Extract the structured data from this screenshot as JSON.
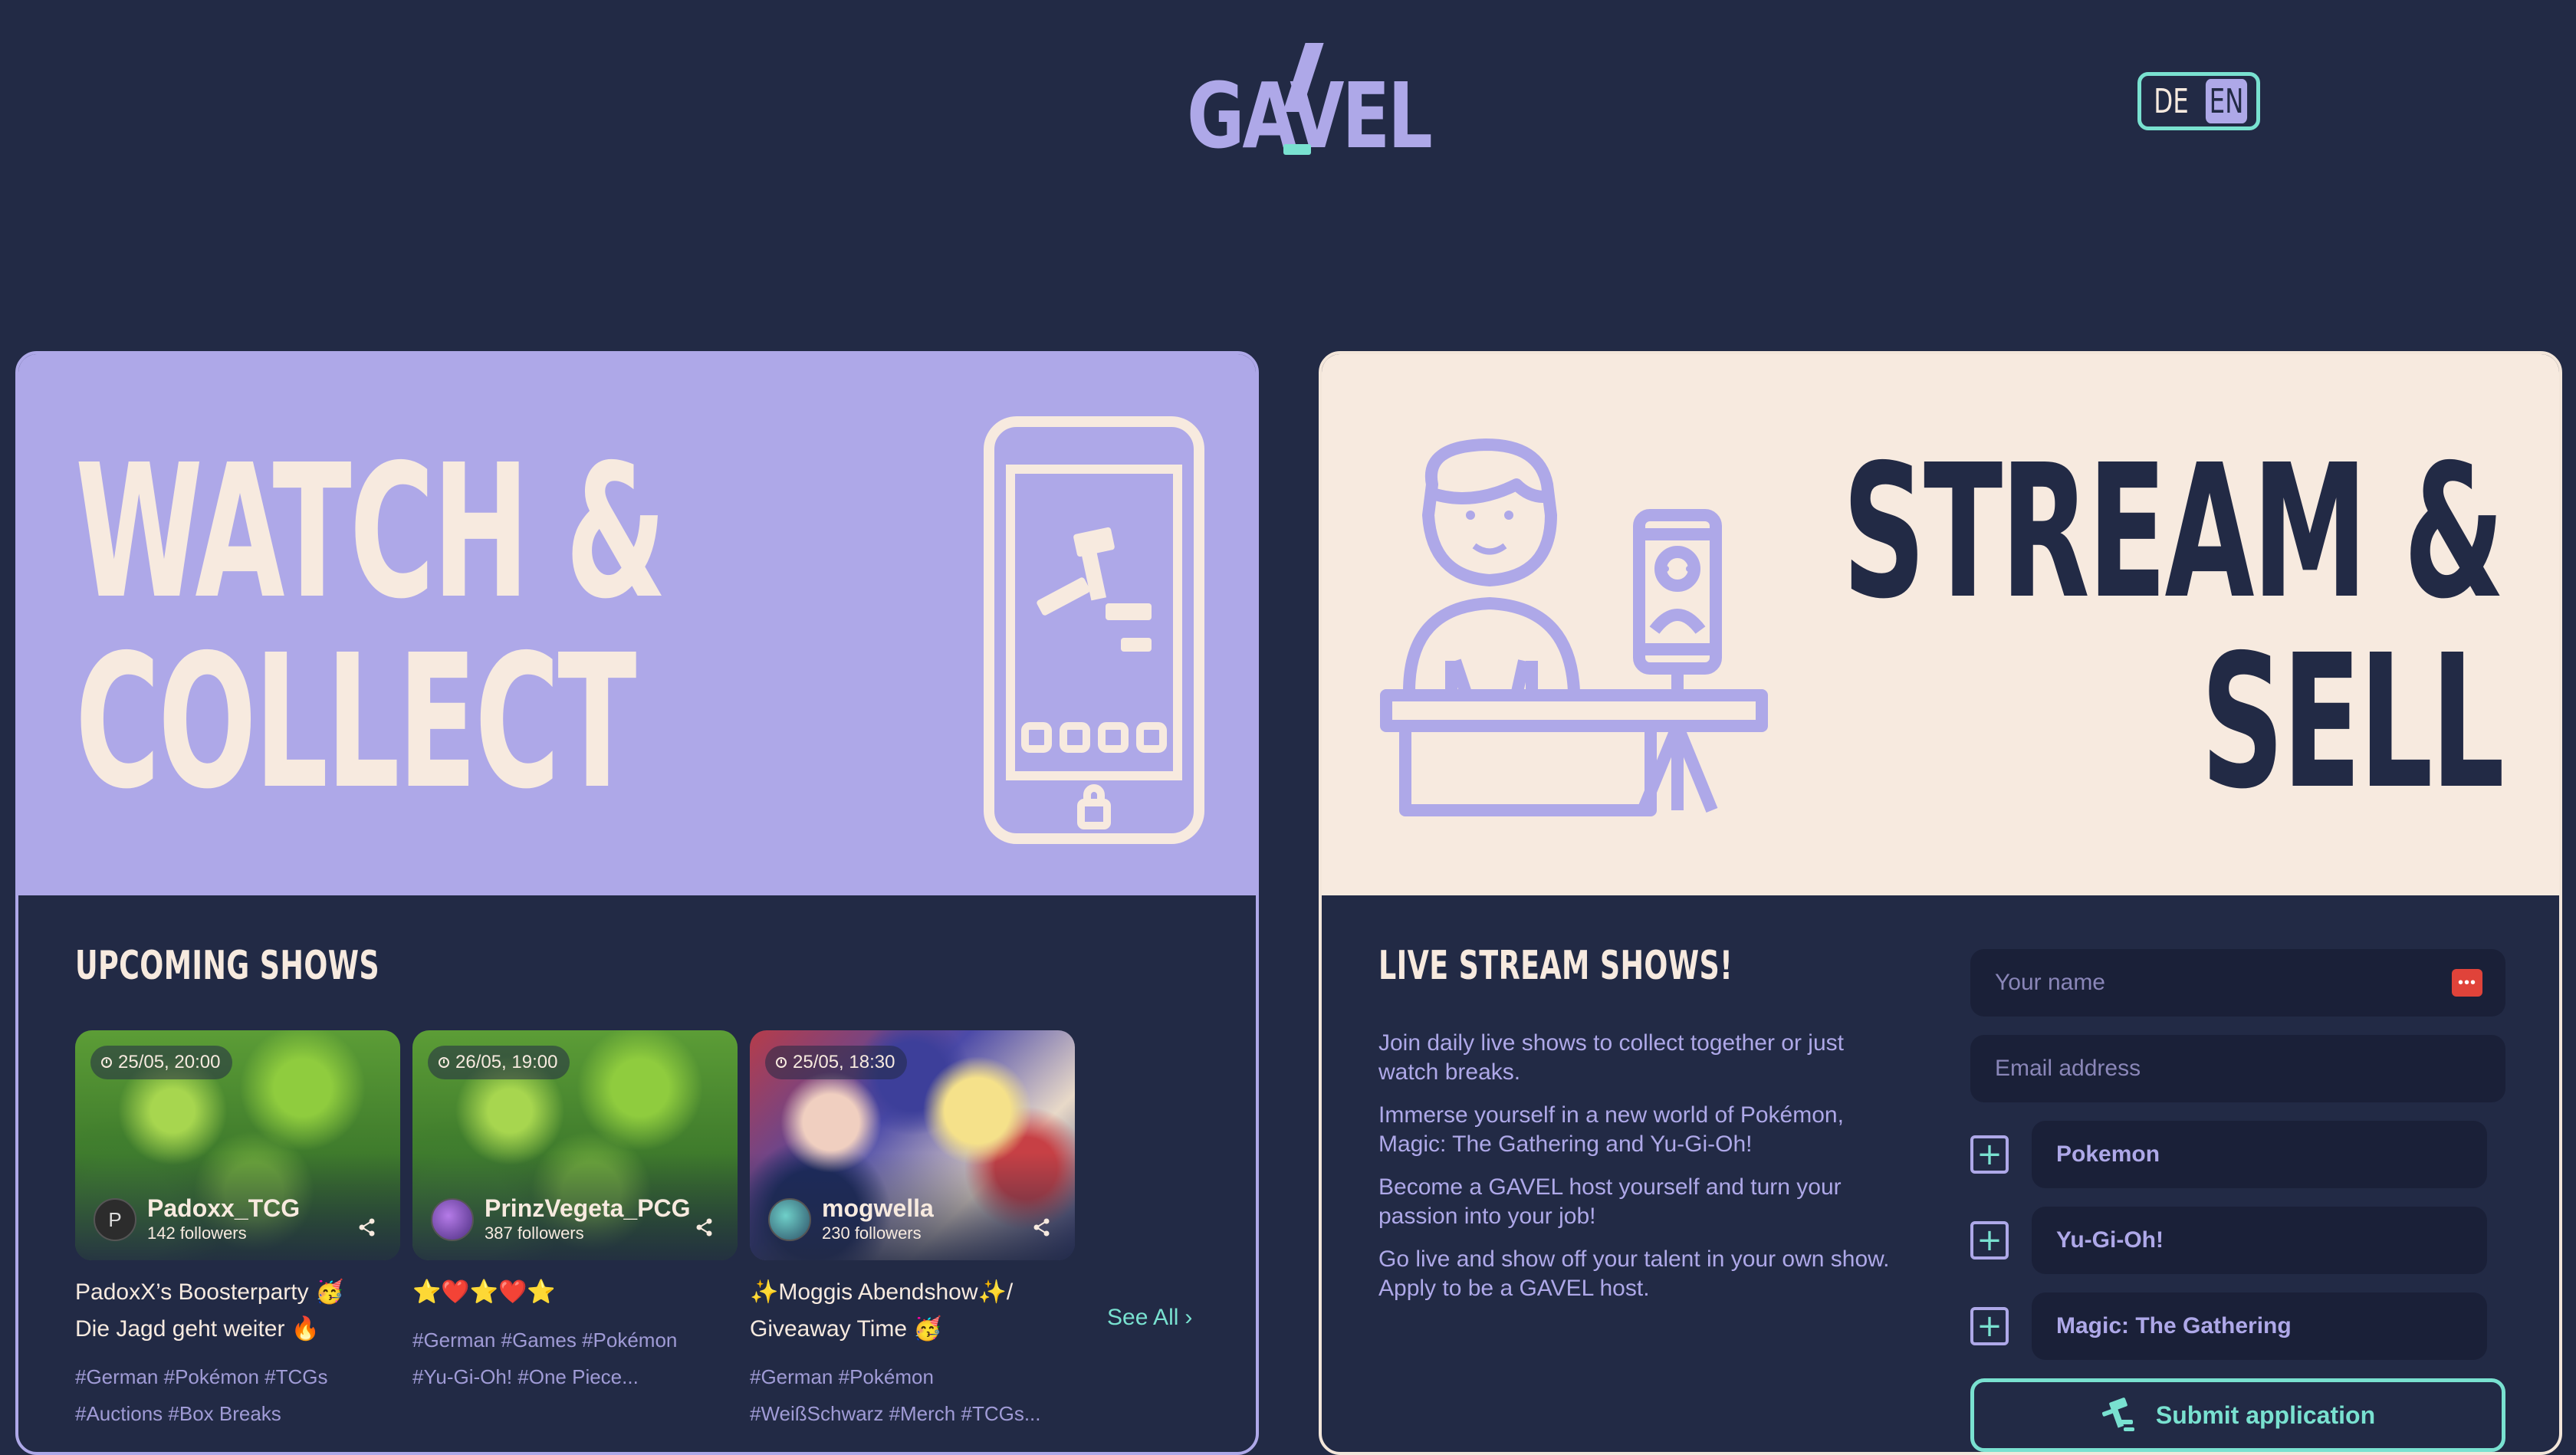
{
  "brand": {
    "logo_text": "GAVEL"
  },
  "language": {
    "options": [
      "DE",
      "EN"
    ],
    "active": "EN"
  },
  "watch": {
    "hero_line1": "WATCH &",
    "hero_line2": "COLLECT",
    "section_title": "UPCOMING SHOWS",
    "see_all": "See All",
    "cards": [
      {
        "time": "25/05, 20:00",
        "host": "Padoxx_TCG",
        "followers": "142 followers",
        "avatar": "P",
        "title_line1": "PadoxX’s Boosterparty 🥳",
        "title_line2": "Die Jagd geht weiter 🔥",
        "tags_line1": "#German #Pokémon #TCGs",
        "tags_line2": "#Auctions #Box Breaks"
      },
      {
        "time": "26/05, 19:00",
        "host": "PrinzVegeta_PCG",
        "followers": "387 followers",
        "avatar": "",
        "title_line1": "⭐❤️⭐❤️⭐",
        "title_line2": "",
        "tags_line1": "#German #Games #Pokémon",
        "tags_line2": "#Yu-Gi-Oh! #One Piece..."
      },
      {
        "time": "25/05, 18:30",
        "host": "mogwella",
        "followers": "230 followers",
        "avatar": "",
        "title_line1": "✨Moggis Abendshow✨/",
        "title_line2": "Giveaway Time 🥳",
        "tags_line1": "#German #Pokémon",
        "tags_line2": "#WeißSchwarz #Merch #TCGs..."
      }
    ]
  },
  "stream": {
    "hero_line1": "STREAM &",
    "hero_line2": "SELL",
    "section_title": "LIVE STREAM SHOWS!",
    "paragraphs": [
      "Join daily live shows to collect together or just watch breaks.",
      "Immerse yourself in a new world of Pokémon, Magic: The Gathering and Yu-Gi-Oh!",
      "Become a GAVEL host yourself and turn your passion into your job!",
      "Go live and show off your talent in your own show. Apply to be a GAVEL host."
    ],
    "form": {
      "name_placeholder": "Your name",
      "email_placeholder": "Email address",
      "options": [
        "Pokemon",
        "Yu-Gi-Oh!",
        "Magic: The Gathering"
      ],
      "submit_label": "Submit application"
    }
  },
  "colors": {
    "background": "#222a45",
    "lavender": "#aea8e8",
    "cream": "#f7eadf",
    "teal": "#79e1d0"
  }
}
